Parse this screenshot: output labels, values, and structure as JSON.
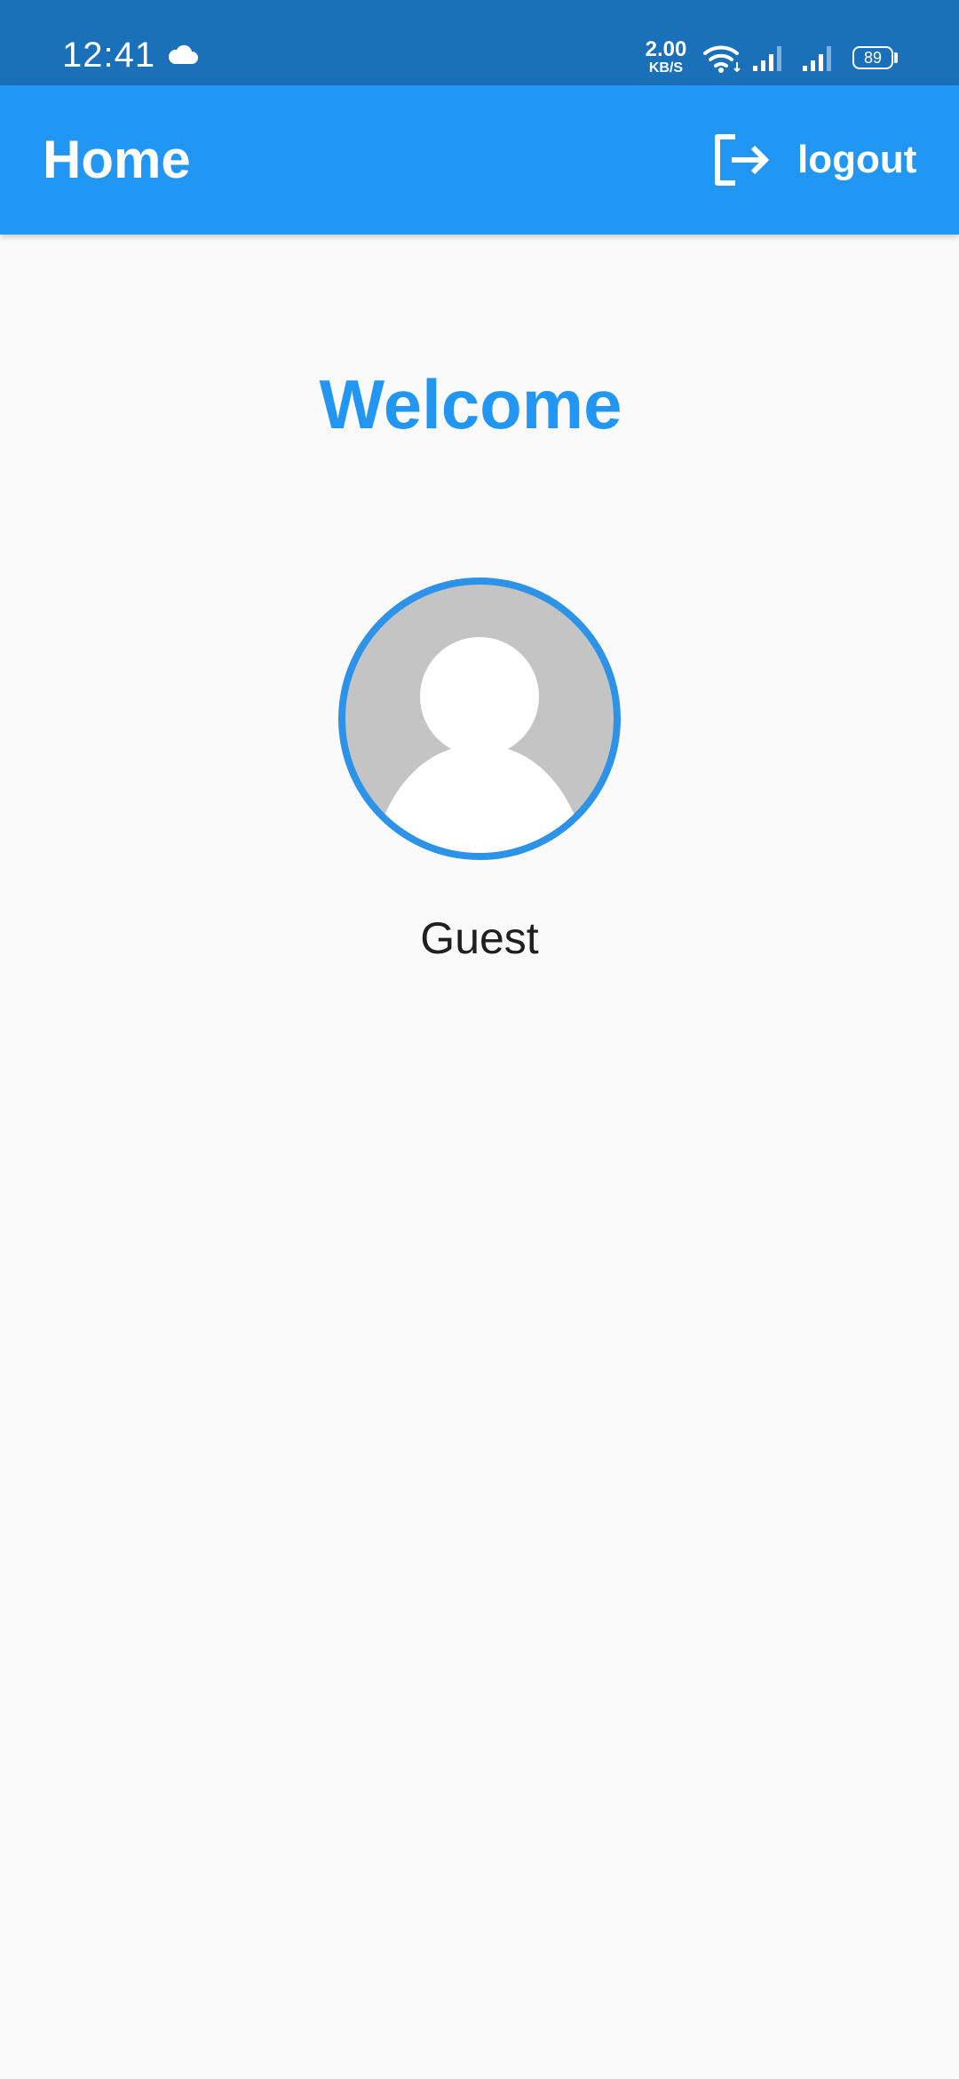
{
  "status_bar": {
    "time": "12:41",
    "net_speed_value": "2.00",
    "net_speed_unit": "KB/S",
    "battery": "89",
    "icons": [
      "cloud-icon",
      "wifi-icon",
      "signal-icon",
      "signal-icon",
      "battery-icon"
    ]
  },
  "app_bar": {
    "title": "Home",
    "logout_label": "logout",
    "logout_icon": "logout-icon"
  },
  "main": {
    "welcome": "Welcome",
    "avatar_icon": "person-icon",
    "username": "Guest"
  },
  "colors": {
    "status_bar": "#1A70B9",
    "app_bar": "#2196F3",
    "accent": "#2196F3",
    "background": "#FAFAFA",
    "avatar_bg": "#C4C4C4",
    "text": "#1F1F1F"
  }
}
